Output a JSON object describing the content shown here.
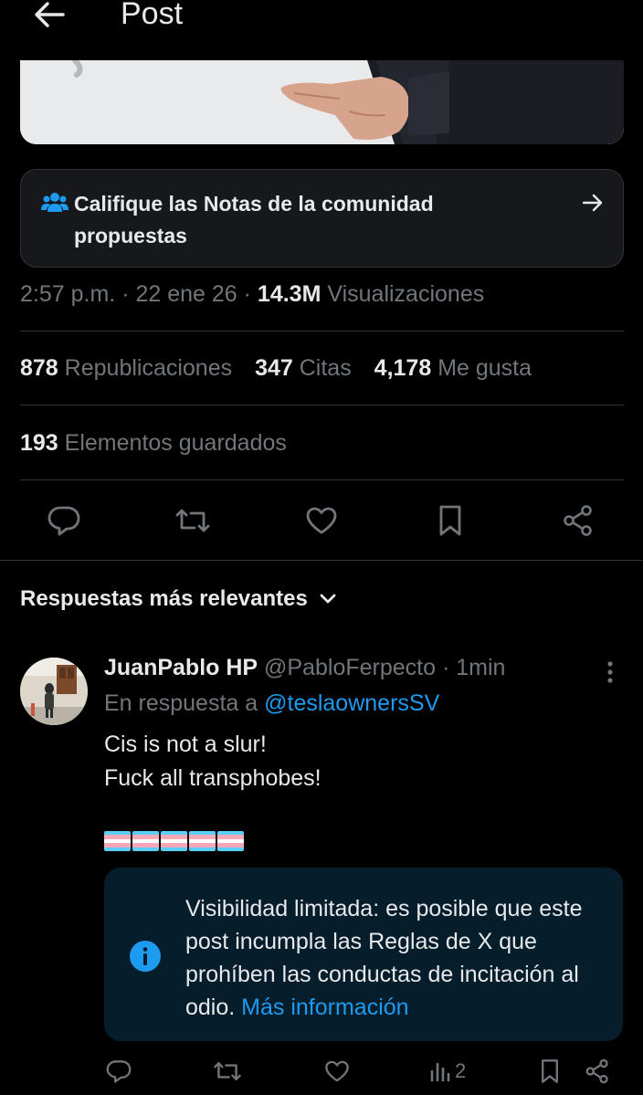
{
  "header": {
    "title": "Post",
    "back_icon": "arrow-left-icon"
  },
  "community_notes": {
    "label": "Califique las Notas de la comunidad propuestas",
    "icon": "people-icon",
    "arrow_icon": "arrow-right-icon"
  },
  "post_meta": {
    "time": "2:57 p.m.",
    "separator": "·",
    "date": "22 ene 26",
    "views_count": "14.3M",
    "views_label": "Visualizaciones"
  },
  "stats": [
    {
      "count": "878",
      "label": "Republicaciones"
    },
    {
      "count": "347",
      "label": "Citas"
    },
    {
      "count": "4,178",
      "label": "Me gusta"
    }
  ],
  "bookmarks": {
    "count": "193",
    "label": "Elementos guardados"
  },
  "actions": [
    "reply-icon",
    "repost-icon",
    "like-icon",
    "bookmark-icon",
    "share-icon"
  ],
  "replies_sort": {
    "label": "Respuestas más relevantes"
  },
  "reply": {
    "display_name": "JuanPablo HP",
    "handle": "@PabloFerpecto",
    "separator": "·",
    "time": "1min",
    "in_reply_prefix": "En respuesta a",
    "in_reply_mention": "@teslaownersSV",
    "text": "Cis is not a slur!\nFuck all transphobes!",
    "flag_count": 5,
    "notice": {
      "text": "Visibilidad limitada: es posible que este post incumpla las Reglas de X que prohíben las conductas de incitación al odio.",
      "link": "Más información"
    },
    "views": "2"
  },
  "colors": {
    "accent": "#1d9bf0",
    "notice_bg": "#061d2b",
    "muted": "#71767b",
    "text": "#e7e9ea"
  }
}
